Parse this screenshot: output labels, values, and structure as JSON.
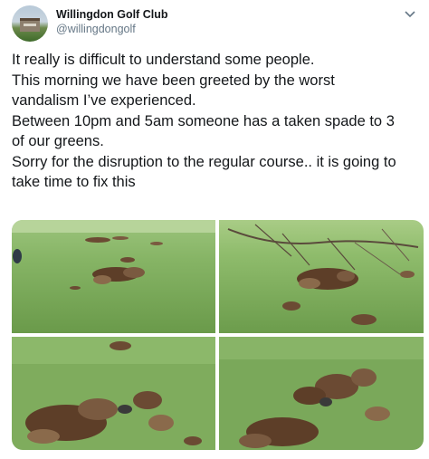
{
  "tweet": {
    "author": {
      "display_name": "Willingdon Golf Club",
      "handle": "@willingdongolf",
      "avatar_icon": "clubhouse-avatar"
    },
    "menu_icon": "chevron-down-icon",
    "text_lines": [
      "It really is difficult to understand some people.",
      "This morning we have been greeted by the worst",
      "vandalism I’ve experienced.",
      "Between 10pm and 5am someone has a taken spade to 3",
      "of our greens.",
      "Sorry for the disruption to the regular course.. it is going to",
      "take time to fix this"
    ],
    "photos": [
      {
        "subject": "damaged green with scattered divots"
      },
      {
        "subject": "torn turf clumps beside fallen branch"
      },
      {
        "subject": "close-up of dug-up turf"
      },
      {
        "subject": "close-up of turf clumps around hole"
      }
    ]
  },
  "colors": {
    "text": "#14171a",
    "secondary_text": "#657786",
    "grass": "#7aa65a",
    "soil": "#6b4a33"
  }
}
